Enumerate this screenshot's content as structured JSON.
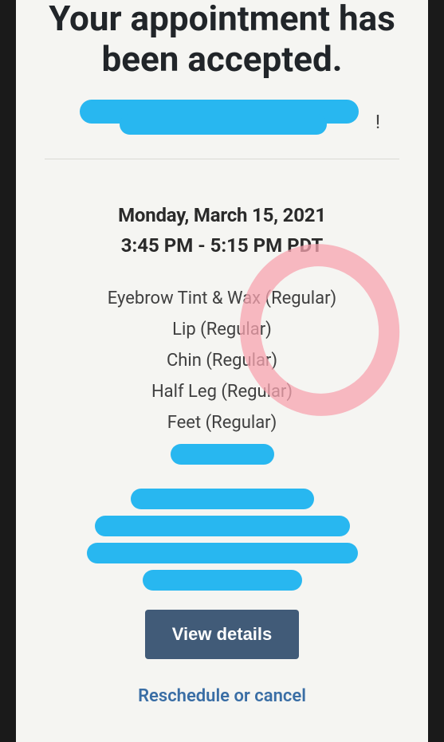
{
  "heading": "Your appointment has been accepted.",
  "appointment": {
    "date": "Monday, March 15, 2021",
    "time": "3:45 PM - 5:15 PM PDT",
    "services": [
      "Eyebrow Tint & Wax (Regular)",
      "Lip (Regular)",
      "Chin (Regular)",
      "Half Leg (Regular)",
      "Feet (Regular)"
    ]
  },
  "actions": {
    "view_details": "View details",
    "reschedule": "Reschedule or cancel"
  },
  "colors": {
    "redaction": "#28b7f0",
    "circle": "rgba(247,163,175,0.75)",
    "button_bg": "#415b78",
    "link": "#3a6ea5"
  }
}
